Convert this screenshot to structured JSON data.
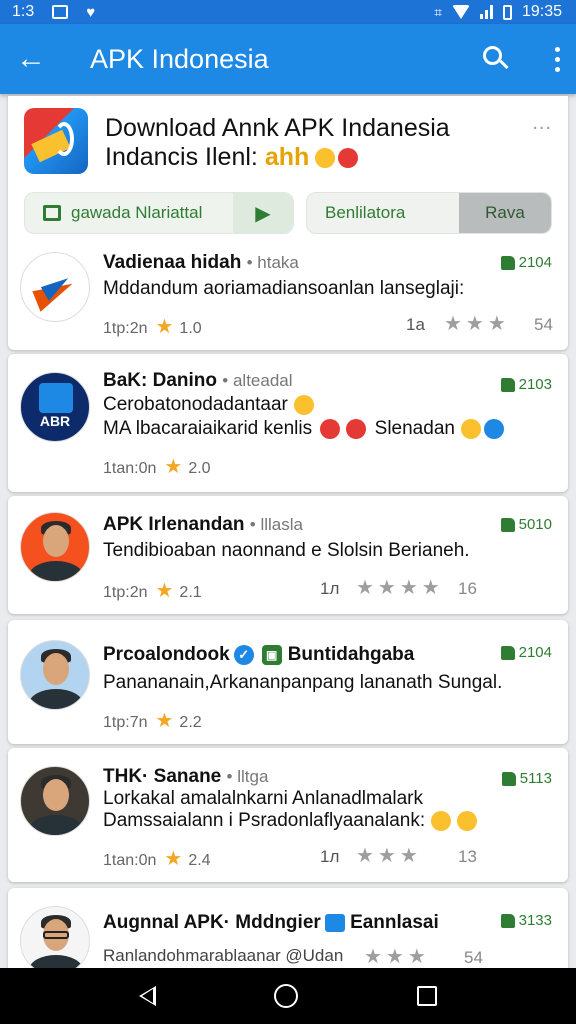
{
  "status_bar": {
    "left_text": "1:3",
    "time": "19:35"
  },
  "app_bar": {
    "title": "APK Indonesia"
  },
  "header": {
    "title_line1": "Download Annk APK Indanesia",
    "title_line2": "Indancis Ilenl: ",
    "title_emoji_text": "ahh",
    "more": "...",
    "pill1_label": "gawada Nlariattal",
    "pill2_label": "Benlilatora",
    "pill2_tab": "Rava"
  },
  "rows": [
    {
      "name": "Vadienaa hidah",
      "sub": "• htaka",
      "line1": "Mddandum aoriamadiansoanlan lanseglaji:",
      "meta": "1tp:2n",
      "rating": "1.0",
      "mid": "1a",
      "stars": "★★★",
      "rnum": "54",
      "count": "2104"
    },
    {
      "name": "BaK: Danino",
      "sub": "• alteadal",
      "line1": "Cerobatonodadantaar",
      "line2": "MA lbacaraiaikarid kenlis",
      "line2_tail": "Slenadan",
      "meta": "1tan:0n",
      "rating": "2.0",
      "count": "2103"
    },
    {
      "name": "APK Irlenandan",
      "sub": "• lllasla",
      "line1": "Tendibioaban naonnand e Slolsin Berianeh.",
      "meta": "1tp:2n",
      "rating": "2.1",
      "mid": "1л",
      "stars": "★★★★",
      "rnum": "16",
      "count": "5010"
    },
    {
      "name": "Prcoalondook",
      "name_tail": "Buntidahgaba",
      "line1": "Panananain,Arkananpanpang lananath Sungal.",
      "meta": "1tp:7n",
      "rating": "2.2",
      "count": "2104"
    },
    {
      "name": "THK· Sanane",
      "sub": "• lltga",
      "line1": "Lorkakal amalalnkarni Anlanadlmalark",
      "line2": "Damssaialann i Psradonlaflyaanalank:",
      "meta": "1tan:0n",
      "rating": "2.4",
      "mid": "1л",
      "stars": "★★★",
      "rnum": "13",
      "count": "5113"
    },
    {
      "name": "Augnnal APK· Mddngier",
      "name_tail": "Eannlasai",
      "line1": "Ranlandohmarablaanar @Udan",
      "stars": "★★★",
      "rnum": "54",
      "count": "3133"
    }
  ]
}
